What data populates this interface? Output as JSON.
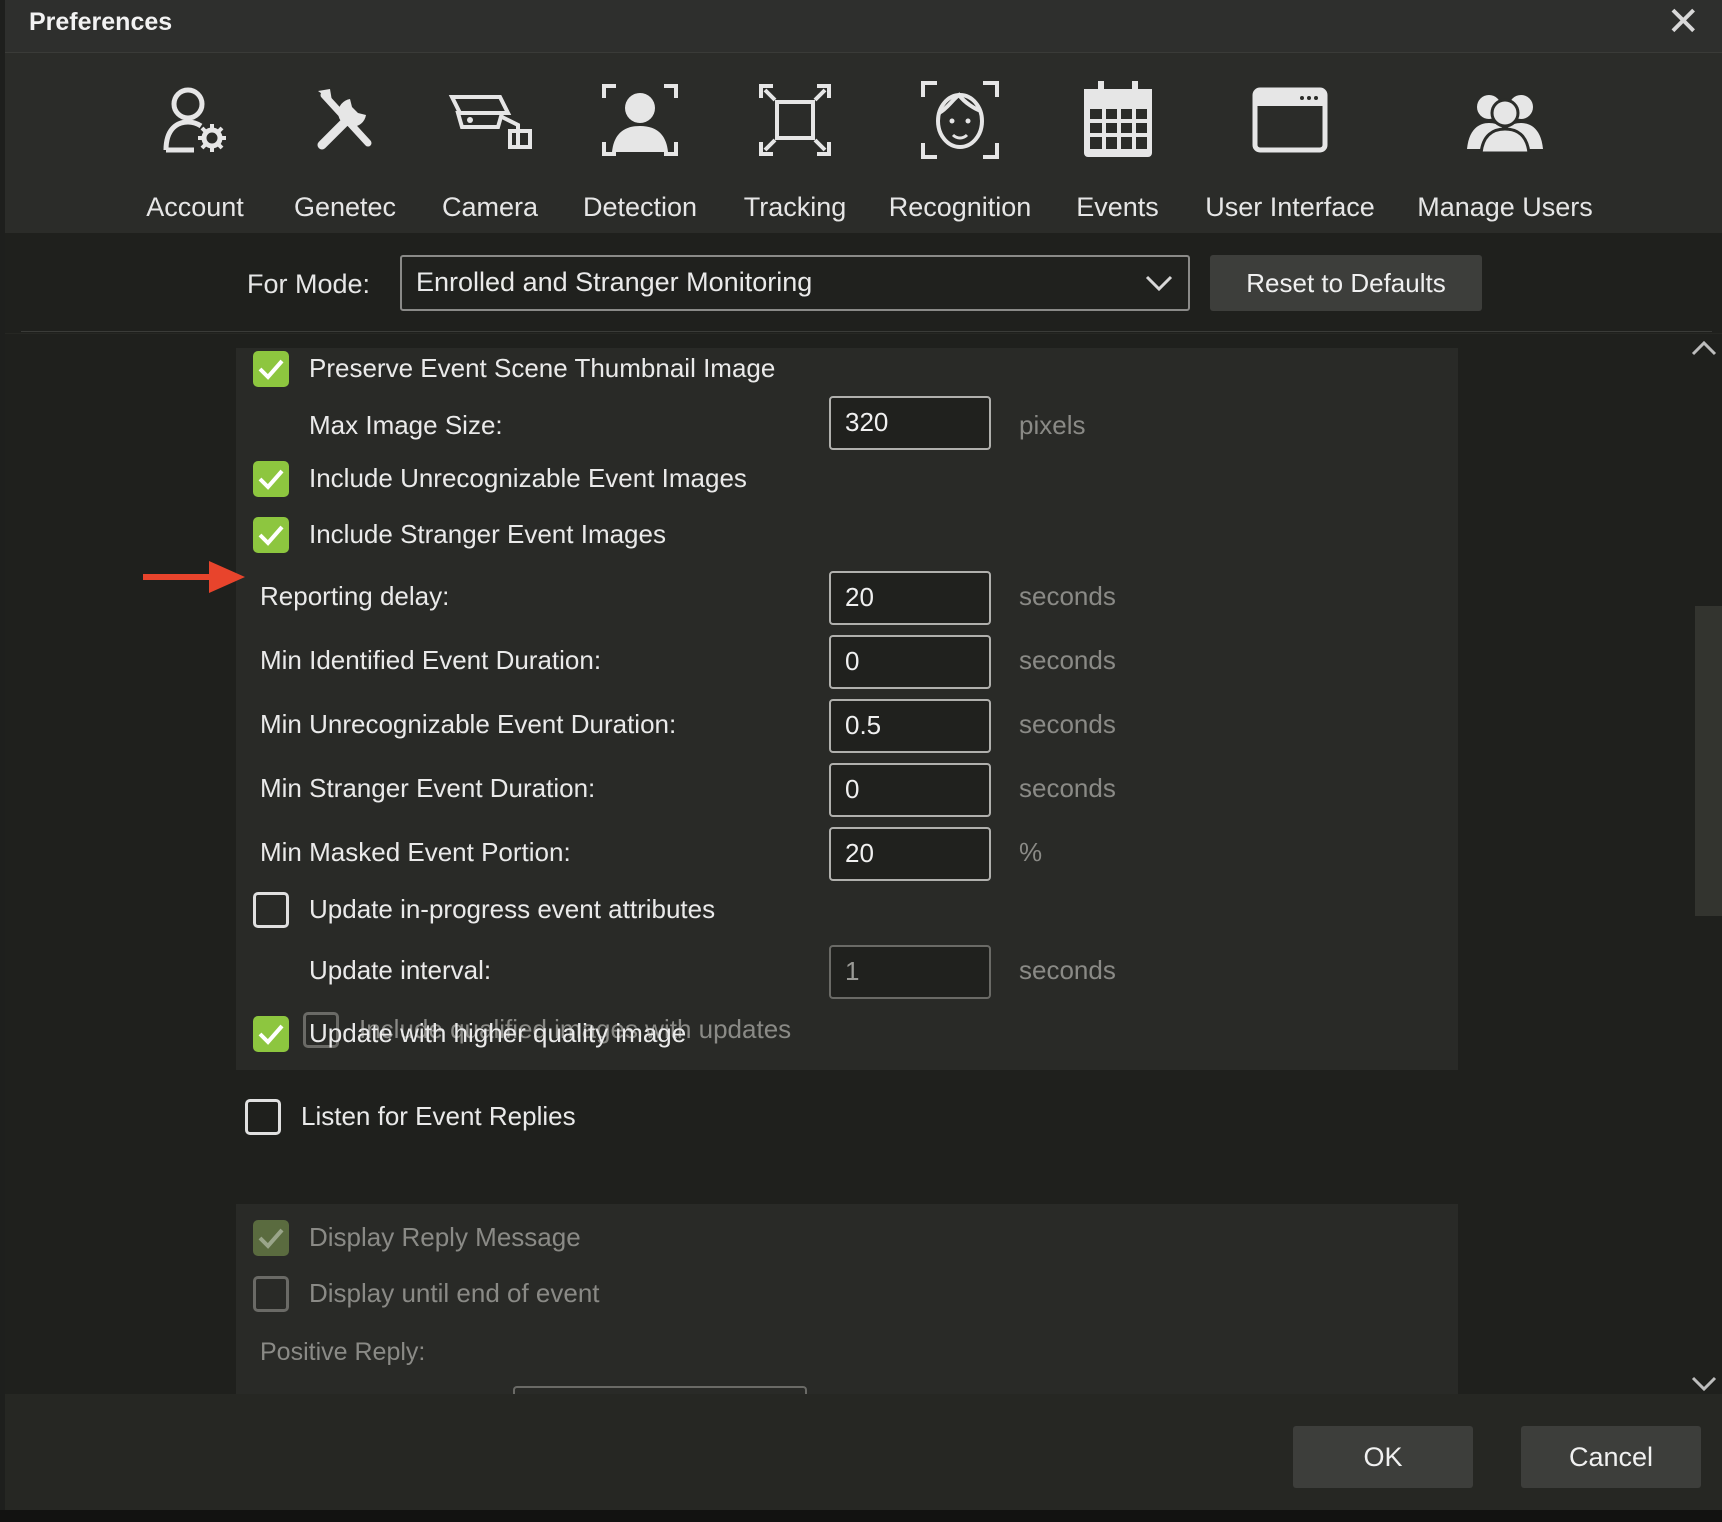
{
  "window": {
    "title": "Preferences",
    "close_icon": "close-icon"
  },
  "toolbar": {
    "items": [
      {
        "label": "Account",
        "icon": "account-icon"
      },
      {
        "label": "Genetec",
        "icon": "tools-icon"
      },
      {
        "label": "Camera",
        "icon": "camera-icon"
      },
      {
        "label": "Detection",
        "icon": "detection-icon"
      },
      {
        "label": "Tracking",
        "icon": "tracking-icon"
      },
      {
        "label": "Recognition",
        "icon": "recognition-icon"
      },
      {
        "label": "Events",
        "icon": "calendar-icon",
        "selected": true
      },
      {
        "label": "User Interface",
        "icon": "window-icon"
      },
      {
        "label": "Manage Users",
        "icon": "users-icon"
      }
    ],
    "accent_color": "#8dc63f"
  },
  "mode": {
    "label": "For Mode:",
    "selected": "Enrolled and Stranger Monitoring",
    "reset_label": "Reset to Defaults"
  },
  "settings": {
    "preserve_thumbnail": {
      "label": "Preserve Event Scene Thumbnail Image",
      "checked": true
    },
    "max_image_size": {
      "label": "Max Image Size:",
      "value": "320",
      "unit": "pixels"
    },
    "include_unrecognizable": {
      "label": "Include Unrecognizable Event Images",
      "checked": true
    },
    "include_stranger": {
      "label": "Include Stranger Event Images",
      "checked": true
    },
    "reporting_delay": {
      "label": "Reporting delay:",
      "value": "20",
      "unit": "seconds"
    },
    "min_identified": {
      "label": "Min Identified Event Duration:",
      "value": "0",
      "unit": "seconds"
    },
    "min_unrecognizable": {
      "label": "Min Unrecognizable Event Duration:",
      "value": "0.5",
      "unit": "seconds"
    },
    "min_stranger": {
      "label": "Min Stranger Event Duration:",
      "value": "0",
      "unit": "seconds"
    },
    "min_masked": {
      "label": "Min Masked Event Portion:",
      "value": "20",
      "unit": "%"
    },
    "update_in_progress": {
      "label": "Update in-progress event attributes",
      "checked": false
    },
    "update_interval": {
      "label": "Update interval:",
      "value": "1",
      "unit": "seconds"
    },
    "include_qualified": {
      "label": "Include qualified images with updates",
      "checked": false
    },
    "update_higher_quality": {
      "label": "Update with higher quality image",
      "checked": true
    },
    "listen_replies": {
      "label": "Listen for Event Replies",
      "checked": false
    },
    "display_reply": {
      "label": "Display Reply Message",
      "checked": true
    },
    "display_until_end": {
      "label": "Display until end of event",
      "checked": false
    },
    "positive_reply": {
      "label": "Positive Reply:"
    }
  },
  "footer": {
    "ok_label": "OK",
    "cancel_label": "Cancel"
  }
}
